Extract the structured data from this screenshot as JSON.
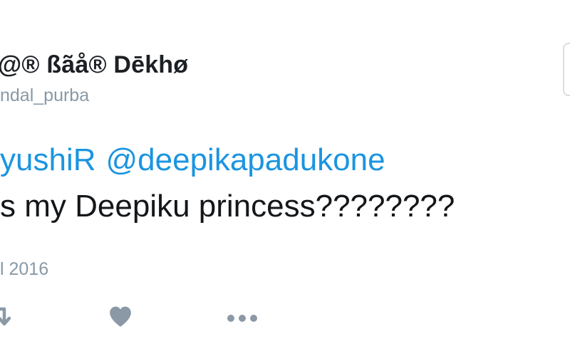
{
  "tweet": {
    "display_name": "@® ßãå® Dēkhø",
    "handle": "ndal_purba",
    "text": {
      "mention_1": "yushiR",
      "mention_2": "@deepikapadukone",
      "line_2": "s  my Deepiku princess????????"
    },
    "timestamp": "l 2016"
  },
  "actions": {
    "retweet_icon": "retweet-icon",
    "like_icon": "heart-icon",
    "more_icon": "more-dots-icon"
  },
  "colors": {
    "mention": "#1b95e0",
    "muted": "#8899a6",
    "text": "#14171a"
  }
}
